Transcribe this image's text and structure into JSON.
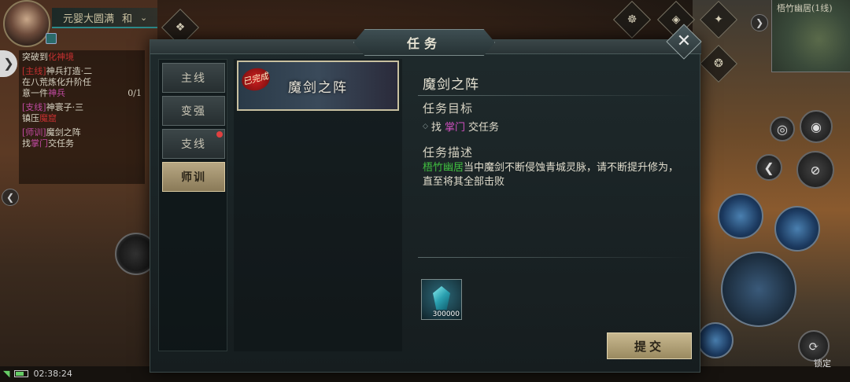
{
  "hud": {
    "realm": "元婴大圆满",
    "harmony": "和",
    "minimap_title": "梧竹幽居(1线)",
    "top_icons": [
      "祈天",
      "签到",
      "坐骑"
    ],
    "lock_label": "锁定",
    "time": "02:38:24",
    "side_toggle": "❯",
    "left_arrow": "❮",
    "right_arrow": "❯"
  },
  "tracker": {
    "items": [
      {
        "prefix": "突破到",
        "highlight": "化神境"
      },
      {
        "tag": "[主线]",
        "title": "神兵打造·二",
        "line2": "在八荒",
        "line2b": "炼化升阶任",
        "line3": "意一件",
        "line3b": "神兵"
      },
      {
        "tag": "[支线]",
        "title": "神寰子·三",
        "line2": "镇压",
        "line2b": "魔窟"
      },
      {
        "tag": "[师训]",
        "title": "魔剑之阵",
        "line2": "找",
        "line2b": "掌门",
        "line2c": "交任务"
      }
    ],
    "count": "0/1"
  },
  "dialog": {
    "title": "任务",
    "close_label": "✕",
    "tabs": [
      {
        "label": "主线",
        "active": false,
        "dot": false
      },
      {
        "label": "变强",
        "active": false,
        "dot": false
      },
      {
        "label": "支线",
        "active": false,
        "dot": true
      },
      {
        "label": "师训",
        "active": true,
        "dot": false
      }
    ],
    "quest_list": [
      {
        "name": "魔剑之阵",
        "status": "已完成"
      }
    ],
    "detail": {
      "name": "魔剑之阵",
      "objective_label": "任务目标",
      "objective_pre": "找",
      "objective_npc": "掌门",
      "objective_post": "交任务",
      "desc_label": "任务描述",
      "desc_place": "梧竹幽居",
      "desc_text": "当中魔剑不断侵蚀青城灵脉，请不断提升修为，直至将其全部击败"
    },
    "reward": {
      "icon": "crystal-icon",
      "count": "300000"
    },
    "submit_label": "提交"
  },
  "colors": {
    "npc_highlight": "#d050c0",
    "place_highlight": "#40c040",
    "red_dot": "#e04040"
  }
}
